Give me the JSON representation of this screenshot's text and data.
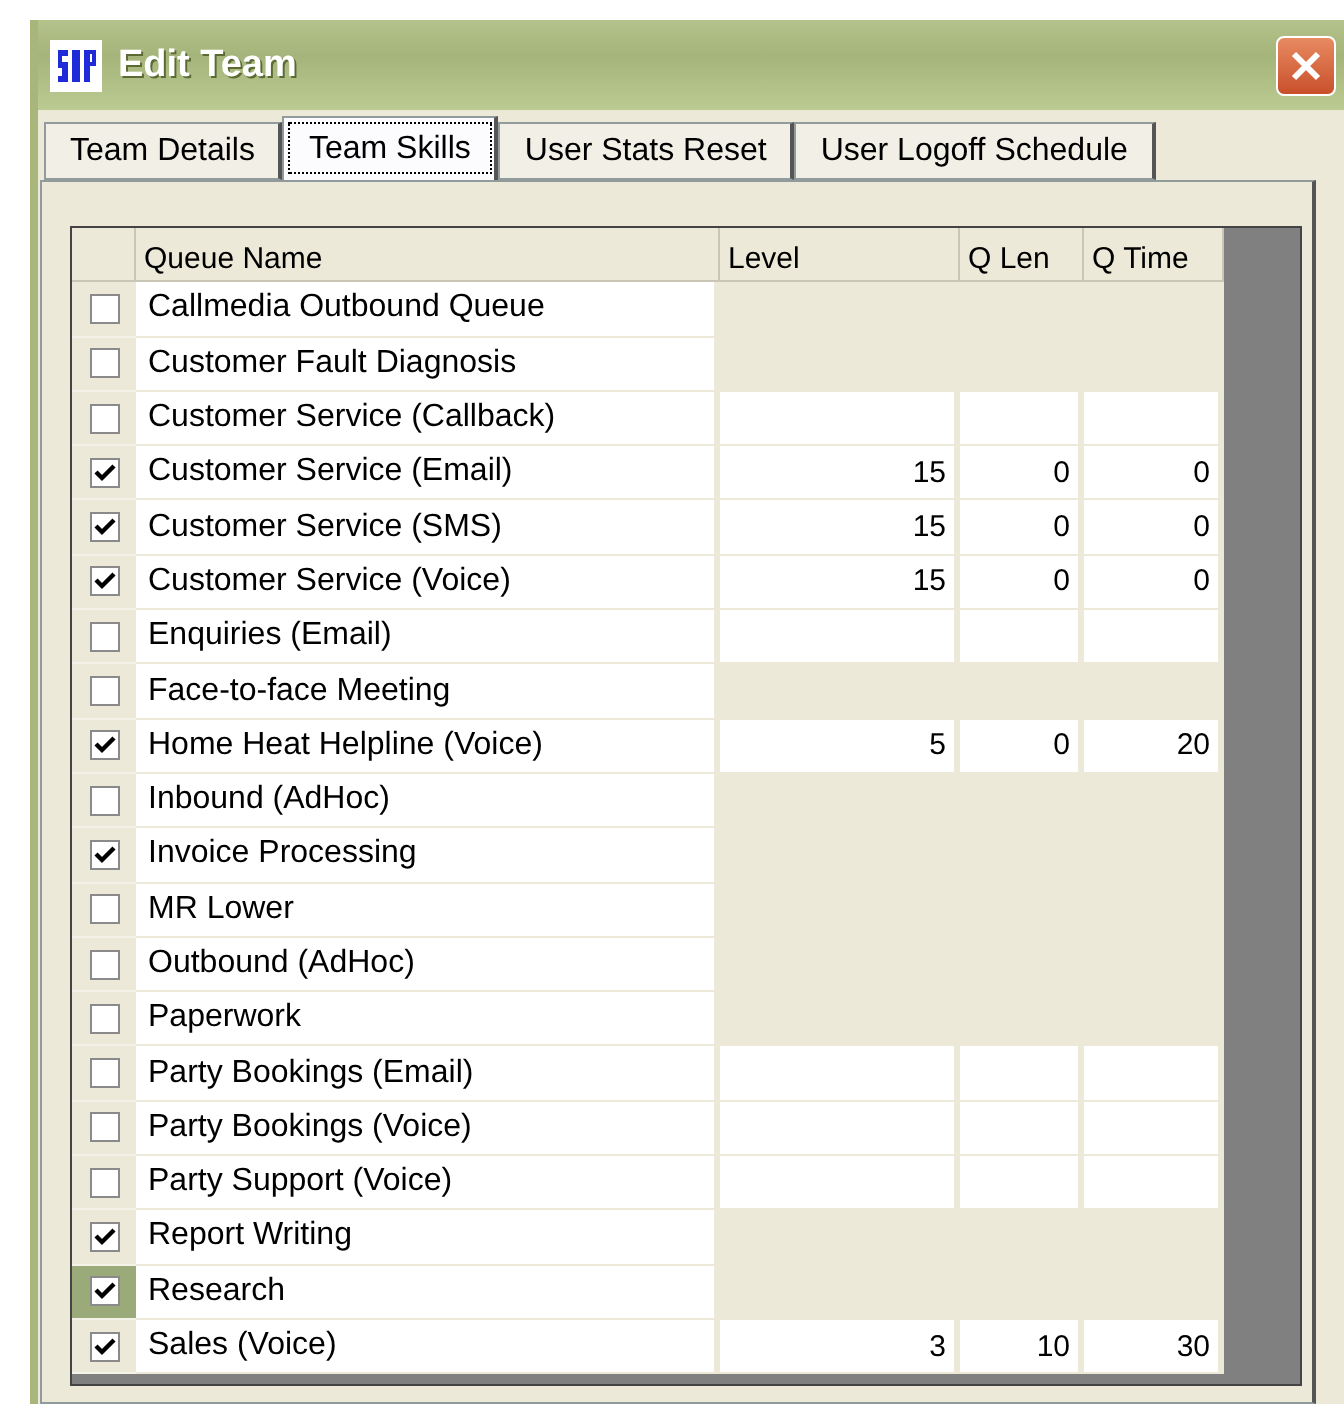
{
  "window": {
    "title": "Edit Team"
  },
  "tabs": [
    {
      "label": "Team Details",
      "selected": false
    },
    {
      "label": "Team Skills",
      "selected": true
    },
    {
      "label": "User Stats Reset",
      "selected": false
    },
    {
      "label": "User Logoff Schedule",
      "selected": false
    }
  ],
  "grid": {
    "columns": [
      "Queue Name",
      "Level",
      "Q Len",
      "Q Time"
    ],
    "rows": [
      {
        "name": "Callmedia Outbound Queue",
        "checked": false,
        "editable": false,
        "selected": false
      },
      {
        "name": "Customer Fault Diagnosis",
        "checked": false,
        "editable": false,
        "selected": false
      },
      {
        "name": "Customer Service (Callback)",
        "checked": false,
        "editable": true,
        "selected": false
      },
      {
        "name": "Customer Service (Email)",
        "checked": true,
        "editable": true,
        "selected": false,
        "level": "15",
        "q_len": "0",
        "q_time": "0"
      },
      {
        "name": "Customer Service (SMS)",
        "checked": true,
        "editable": true,
        "selected": false,
        "level": "15",
        "q_len": "0",
        "q_time": "0"
      },
      {
        "name": "Customer Service (Voice)",
        "checked": true,
        "editable": true,
        "selected": false,
        "level": "15",
        "q_len": "0",
        "q_time": "0"
      },
      {
        "name": "Enquiries (Email)",
        "checked": false,
        "editable": true,
        "selected": false
      },
      {
        "name": "Face-to-face Meeting",
        "checked": false,
        "editable": false,
        "selected": false
      },
      {
        "name": "Home Heat Helpline (Voice)",
        "checked": true,
        "editable": true,
        "selected": false,
        "level": "5",
        "q_len": "0",
        "q_time": "20"
      },
      {
        "name": "Inbound (AdHoc)",
        "checked": false,
        "editable": false,
        "selected": false
      },
      {
        "name": "Invoice Processing",
        "checked": true,
        "editable": false,
        "selected": false
      },
      {
        "name": "MR Lower",
        "checked": false,
        "editable": false,
        "selected": false
      },
      {
        "name": "Outbound (AdHoc)",
        "checked": false,
        "editable": false,
        "selected": false
      },
      {
        "name": "Paperwork",
        "checked": false,
        "editable": false,
        "selected": false
      },
      {
        "name": "Party Bookings (Email)",
        "checked": false,
        "editable": true,
        "selected": false
      },
      {
        "name": "Party Bookings (Voice)",
        "checked": false,
        "editable": true,
        "selected": false
      },
      {
        "name": "Party Support (Voice)",
        "checked": false,
        "editable": true,
        "selected": false
      },
      {
        "name": "Report Writing",
        "checked": true,
        "editable": false,
        "selected": false
      },
      {
        "name": "Research",
        "checked": true,
        "editable": false,
        "selected": true
      },
      {
        "name": "Sales (Voice)",
        "checked": true,
        "editable": true,
        "selected": false,
        "level": "3",
        "q_len": "10",
        "q_time": "30"
      }
    ]
  }
}
